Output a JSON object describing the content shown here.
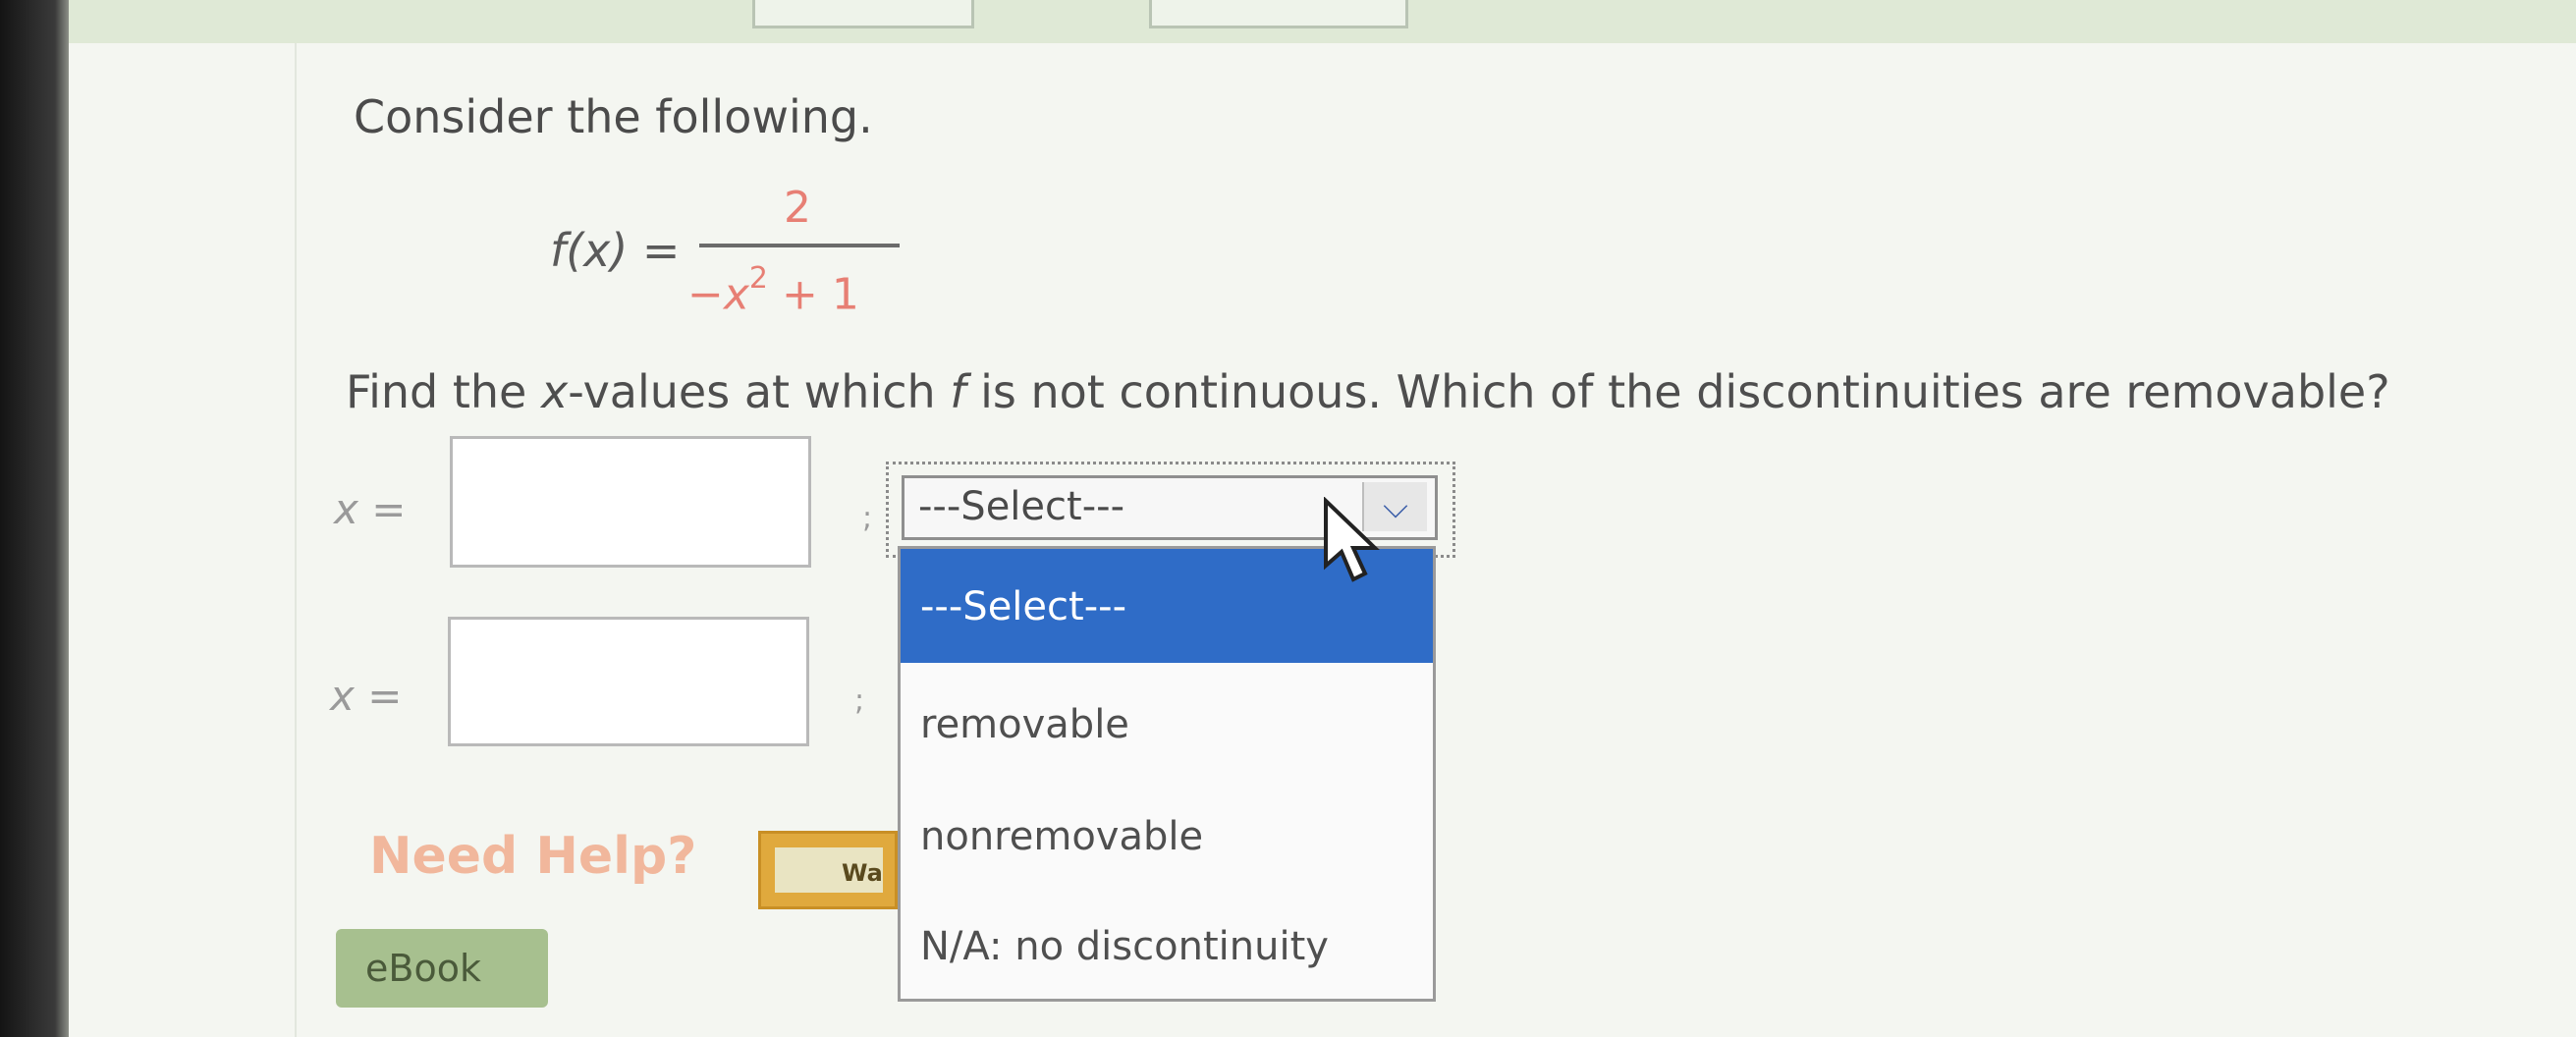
{
  "question": {
    "heading": "Consider the following.",
    "function_label": "f(x) =",
    "numerator": "2",
    "denominator_base": "−x",
    "denominator_exp": "2",
    "denominator_rest": " + 1",
    "prompt_part1": "Find the ",
    "prompt_var": "x",
    "prompt_part2": "-values at which ",
    "prompt_f": "f",
    "prompt_part3": " is not continuous. Which of the discontinuities are removable?"
  },
  "answers": [
    {
      "label": "x =",
      "value": "",
      "separator": ";"
    },
    {
      "label": "x =",
      "value": "",
      "separator": ";"
    }
  ],
  "select": {
    "current": "---Select---",
    "options": [
      "---Select---",
      "removable",
      "nonremovable",
      "N/A: no discontinuity"
    ]
  },
  "help": {
    "label": "Need Help?",
    "watch_label": "Wa"
  },
  "ebook": {
    "label": "eBook"
  },
  "colors": {
    "selected_option": "#2f6cc7",
    "math_red": "#e77f74",
    "help_text": "#f1b79c",
    "ebook_bg": "#a7c08f"
  }
}
